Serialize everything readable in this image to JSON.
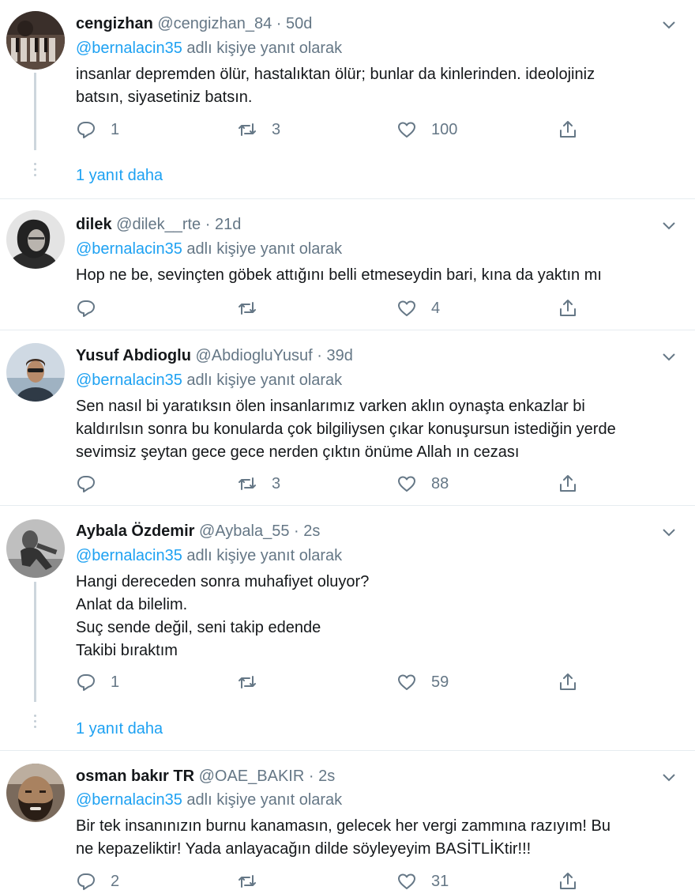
{
  "tweets": [
    {
      "name": "cengizhan",
      "handle": "@cengizhan_84",
      "sep": "·",
      "time": "50d",
      "replying_mention": "@bernalacin35",
      "replying_suffix": "adlı kişiye yanıt olarak",
      "text": "insanlar depremden ölür, hastalıktan ölür; bunlar da kinlerinden. ideolojiniz\nbatsın, siyasetiniz batsın.",
      "replies": "1",
      "retweets": "3",
      "likes": "100",
      "more_replies": "1 yanıt daha"
    },
    {
      "name": "dilek",
      "handle": "@dilek__rte",
      "sep": "·",
      "time": "21d",
      "replying_mention": "@bernalacin35",
      "replying_suffix": "adlı kişiye yanıt olarak",
      "text": "Hop ne be, sevinçten göbek attığını belli etmeseydin bari, kına da yaktın mı",
      "replies": "",
      "retweets": "",
      "likes": "4"
    },
    {
      "name": "Yusuf Abdioglu",
      "handle": "@AbdiogluYusuf",
      "sep": "·",
      "time": "39d",
      "replying_mention": "@bernalacin35",
      "replying_suffix": "adlı kişiye yanıt olarak",
      "text": "Sen nasıl bi yaratıksın ölen insanlarımız varken aklın oynaşta enkazlar bi\nkaldırılsın sonra bu konularda çok bilgiliysen çıkar konuşursun istediğin yerde\nsevimsiz şeytan gece gece nerden çıktın önüme Allah ın cezası",
      "replies": "",
      "retweets": "3",
      "likes": "88"
    },
    {
      "name": "Aybala Özdemir",
      "handle": "@Aybala_55",
      "sep": "·",
      "time": "2s",
      "replying_mention": "@bernalacin35",
      "replying_suffix": "adlı kişiye yanıt olarak",
      "text": "Hangi dereceden sonra muhafiyet oluyor?\nAnlat da bilelim.\nSuç sende değil, seni takip edende\nTakibi bıraktım",
      "replies": "1",
      "retweets": "",
      "likes": "59",
      "more_replies": "1 yanıt daha"
    },
    {
      "name": "osman bakır TR",
      "handle": "@OAE_BAKIR",
      "sep": "·",
      "time": "2s",
      "replying_mention": "@bernalacin35",
      "replying_suffix": "adlı kişiye yanıt olarak",
      "text": "Bir tek insanınızın burnu kanamasın, gelecek her vergi zammına razıyım! Bu\nne kepazeliktir! Yada anlayacağın dilde söyleyeyim BASİTLİKtir!!!",
      "replies": "2",
      "retweets": "",
      "likes": "31"
    }
  ],
  "icons": {
    "reply": "reply-icon",
    "retweet": "retweet-icon",
    "like": "like-icon",
    "share": "share-icon",
    "caret": "chevron-down-icon"
  },
  "colors": {
    "link": "#1da1f2",
    "muted": "#657786",
    "text": "#14171a",
    "divider": "#e6ecf0"
  }
}
